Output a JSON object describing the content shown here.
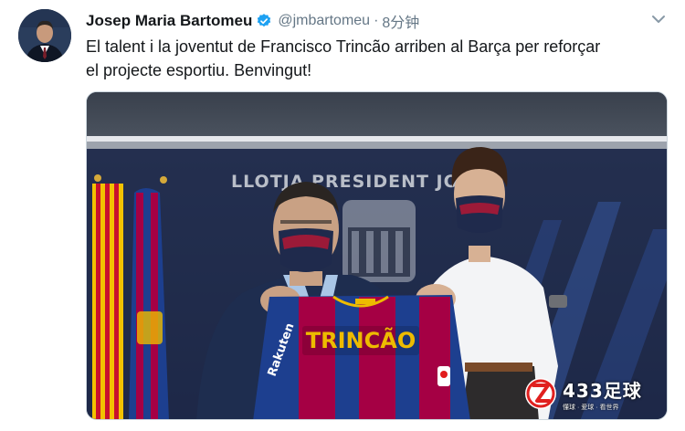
{
  "tweet": {
    "display_name": "Josep Maria Bartomeu",
    "handle": "@jmbartomeu",
    "separator": "·",
    "timestamp": "8分钟",
    "text_line1": "El talent i la joventut de Francisco Trincão arriben al Barça per reforçar",
    "text_line2": "el projecte esportiu. Benvingut!"
  },
  "media": {
    "wall_sign": "LLOTJA PRESIDENT JOSEP",
    "jersey_name": "TRINCÃO",
    "sponsor": "Rakuten"
  },
  "icons": {
    "verified": "verified-badge-icon",
    "caret": "chevron-down-icon"
  },
  "watermark": {
    "title": "433足球",
    "subtitle": "懂球 · 爱球 · 看世界"
  },
  "colors": {
    "verified_blue": "#1da1f2",
    "secondary_text": "#657786",
    "barca_blue": "#1d3f8f",
    "barca_red": "#a50044",
    "barca_gold": "#edbb00"
  }
}
